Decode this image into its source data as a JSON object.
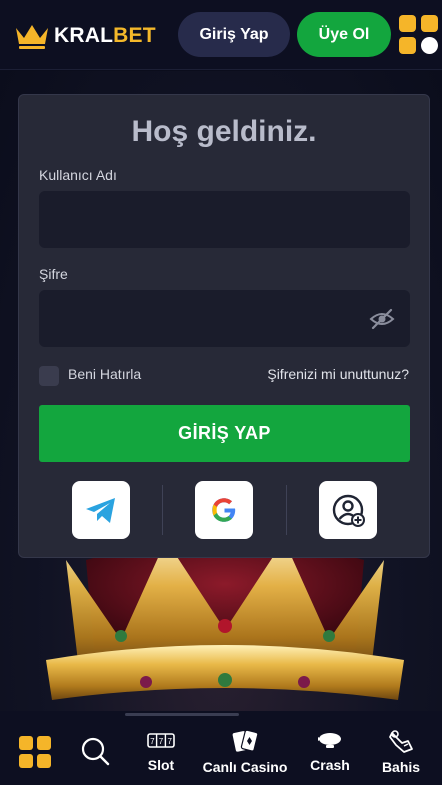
{
  "header": {
    "logo_part1": "KRAL",
    "logo_part2": "BET",
    "login_button": "Giriş Yap",
    "register_button": "Üye Ol"
  },
  "login_card": {
    "title": "Hoş geldiniz.",
    "username_label": "Kullanıcı Adı",
    "username_value": "",
    "password_label": "Şifre",
    "password_value": "",
    "remember_me": "Beni Hatırla",
    "remember_checked": false,
    "forgot_password": "Şifrenizi mi unuttunuz?",
    "submit_button": "GİRİŞ YAP",
    "social_logins": [
      "telegram-icon",
      "google-icon",
      "add-account-icon"
    ]
  },
  "bottom_nav": {
    "items": [
      {
        "label": "",
        "icon": "grid-menu-icon"
      },
      {
        "label": "",
        "icon": "search-icon"
      },
      {
        "label": "Slot",
        "icon": "slot-machine-icon"
      },
      {
        "label": "Canlı Casino",
        "icon": "playing-cards-icon"
      },
      {
        "label": "Crash",
        "icon": "zeppelin-icon"
      },
      {
        "label": "Bahis",
        "icon": "sports-icon"
      }
    ]
  },
  "colors": {
    "background": "#0b0d1c",
    "card": "#272937",
    "accent_green": "#13a63e",
    "accent_gold": "#f5b529",
    "login_button": "#272b4b"
  }
}
